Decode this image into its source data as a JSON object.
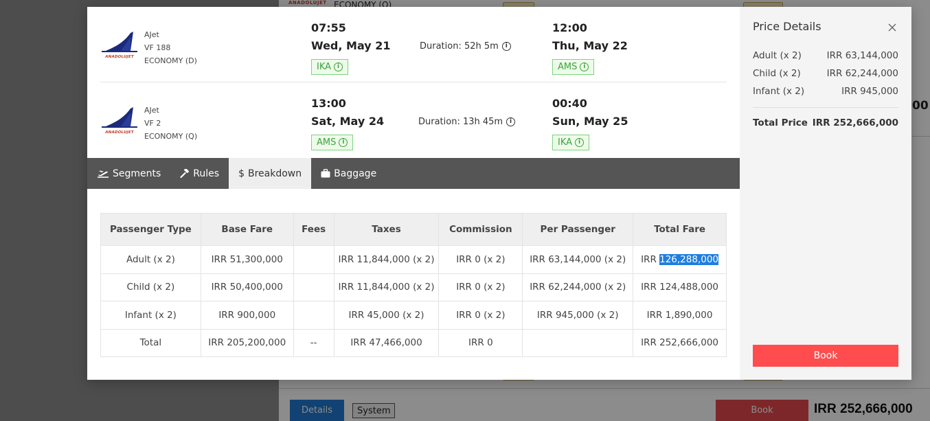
{
  "background": {
    "airline_logo_text": "ANADOLUJET",
    "econ_text": "ECONOMY (Q)",
    "details_label": "Details",
    "system_label": "System",
    "book_label": "Book",
    "total_price": "IRR 252,666,000",
    "partial_price": "00"
  },
  "flights": [
    {
      "airline": "AJet",
      "flight_no": "VF 188",
      "cabin": "ECONOMY (D)",
      "logo_text": "ANADOLUJET",
      "dep_time": "07:55",
      "dep_date": "Wed, May 21",
      "dep_airport": "IKA",
      "duration": "Duration: 52h 5m",
      "arr_time": "12:00",
      "arr_date": "Thu, May 22",
      "arr_airport": "AMS"
    },
    {
      "airline": "AJet",
      "flight_no": "VF 2",
      "cabin": "ECONOMY (Q)",
      "logo_text": "ANADOLUJET",
      "dep_time": "13:00",
      "dep_date": "Sat, May 24",
      "dep_airport": "AMS",
      "duration": "Duration: 13h 45m",
      "arr_time": "00:40",
      "arr_date": "Sun, May 25",
      "arr_airport": "IKA"
    }
  ],
  "tabs": [
    {
      "label": "Segments",
      "icon": "plane-departure-icon",
      "active": false
    },
    {
      "label": "Rules",
      "icon": "gavel-icon",
      "active": false
    },
    {
      "label": "Breakdown",
      "icon": "dollar-icon",
      "active": true
    },
    {
      "label": "Baggage",
      "icon": "suitcase-icon",
      "active": false
    }
  ],
  "breakdown": {
    "headers": [
      "Passenger Type",
      "Base Fare",
      "Fees",
      "Taxes",
      "Commission",
      "Per Passenger",
      "Total Fare"
    ],
    "rows": [
      [
        "Adult (x 2)",
        "IRR 51,300,000",
        "",
        "IRR 11,844,000 (x 2)",
        "IRR 0 (x 2)",
        "IRR 63,144,000 (x 2)",
        "IRR 126,288,000"
      ],
      [
        "Child (x 2)",
        "IRR 50,400,000",
        "",
        "IRR 11,844,000 (x 2)",
        "IRR 0 (x 2)",
        "IRR 62,244,000 (x 2)",
        "IRR 124,488,000"
      ],
      [
        "Infant (x 2)",
        "IRR 900,000",
        "",
        "IRR 45,000 (x 2)",
        "IRR 0 (x 2)",
        "IRR 945,000 (x 2)",
        "IRR 1,890,000"
      ],
      [
        "Total",
        "IRR 205,200,000",
        "--",
        "IRR 47,466,000",
        "IRR 0",
        "",
        "IRR 252,666,000"
      ]
    ],
    "selected_prefix": "IRR ",
    "selected_text": "126,288,000"
  },
  "price_details": {
    "title": "Price Details",
    "rows": [
      {
        "label": "Adult (x 2)",
        "value": "IRR 63,144,000"
      },
      {
        "label": "Child (x 2)",
        "value": "IRR 62,244,000"
      },
      {
        "label": "Infant (x 2)",
        "value": "IRR 945,000"
      }
    ],
    "total_label": "Total Price",
    "total_value": "IRR 252,666,000",
    "book_label": "Book"
  },
  "colors": {
    "tab_bar": "#555555",
    "tab_active": "#eeeeee",
    "airport_chip_border": "#7dd37d",
    "airport_chip_text": "#3da33d",
    "book_button": "#ff4d4f",
    "selection": "#1f7ee0"
  }
}
